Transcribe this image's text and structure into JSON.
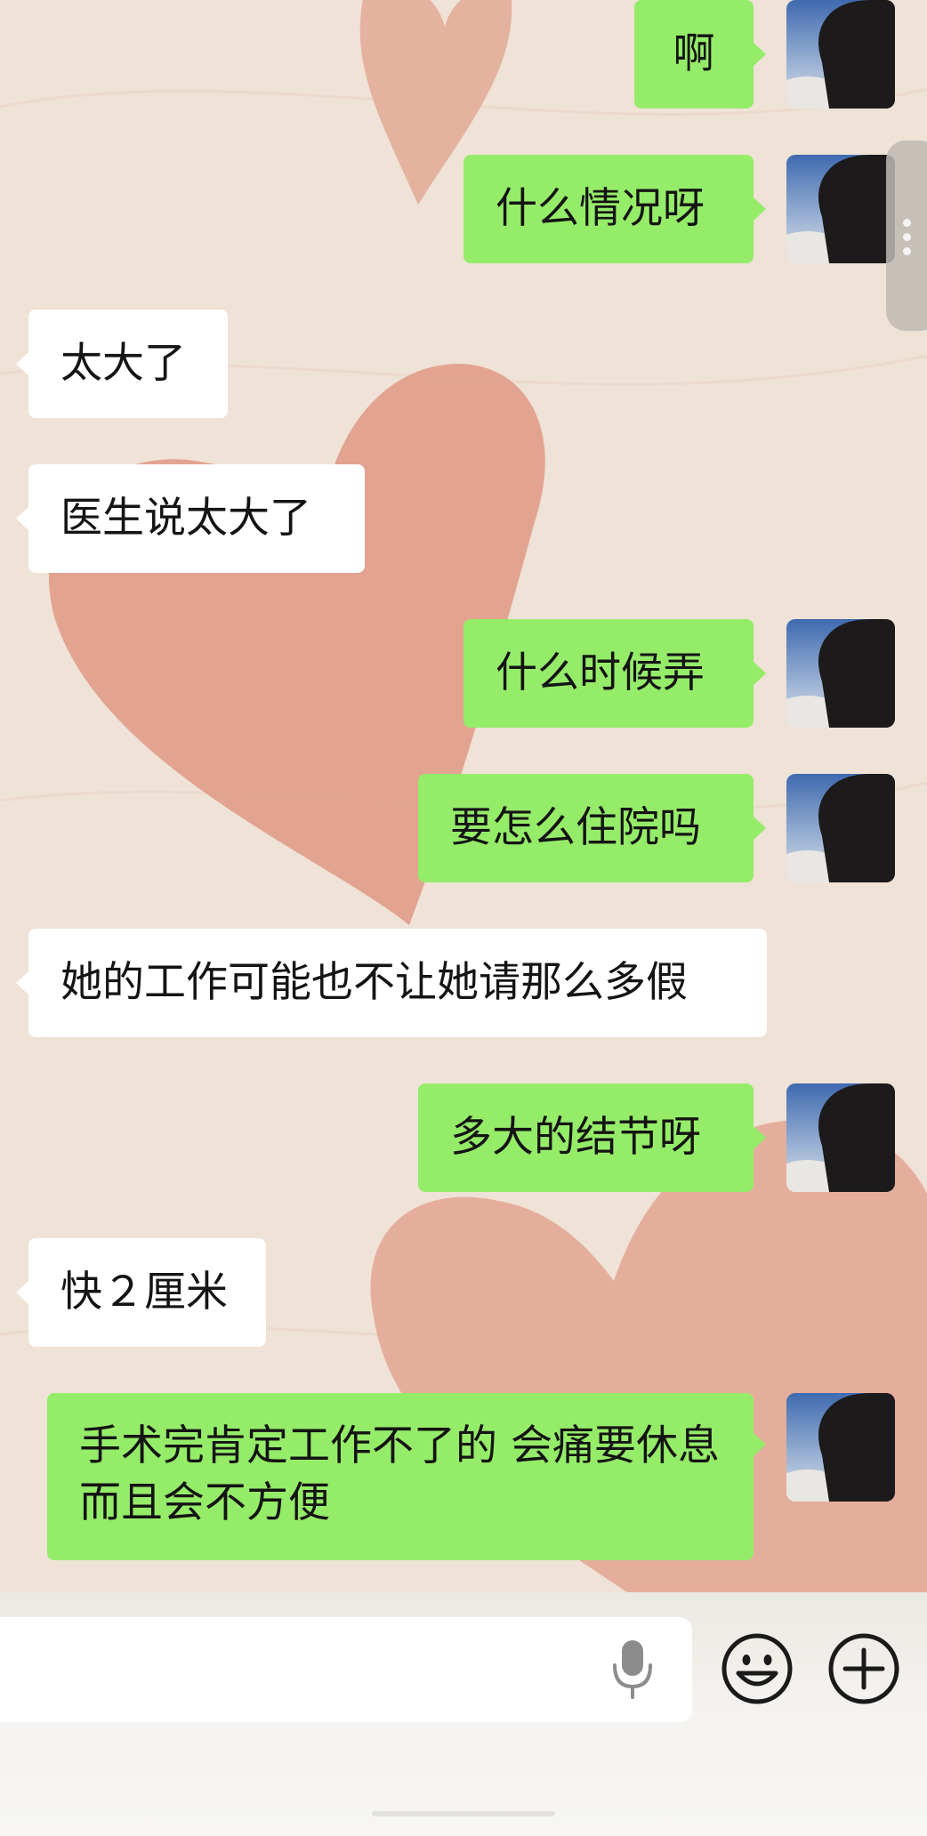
{
  "messages": [
    {
      "side": "out",
      "text": "啊"
    },
    {
      "side": "out",
      "text": "什么情况呀"
    },
    {
      "side": "in",
      "text": "太大了"
    },
    {
      "side": "in",
      "text": "医生说太大了"
    },
    {
      "side": "out",
      "text": "什么时候弄"
    },
    {
      "side": "out",
      "text": "要怎么住院吗"
    },
    {
      "side": "in",
      "text": "她的工作可能也不让她请那么多假"
    },
    {
      "side": "out",
      "text": "多大的结节呀"
    },
    {
      "side": "in",
      "text": "快２厘米"
    },
    {
      "side": "out",
      "text": "手术完肯定工作不了的 会痛要休息而且会不方便"
    }
  ],
  "input_bar": {
    "mic_icon": "microphone-icon",
    "emoji_icon": "emoji-smiley-icon",
    "plus_icon": "plus-circle-icon"
  },
  "colors": {
    "outgoing_bubble": "#95ec69",
    "incoming_bubble": "#ffffff",
    "wallpaper": "#efe2d6",
    "heart": "#e0a391"
  }
}
